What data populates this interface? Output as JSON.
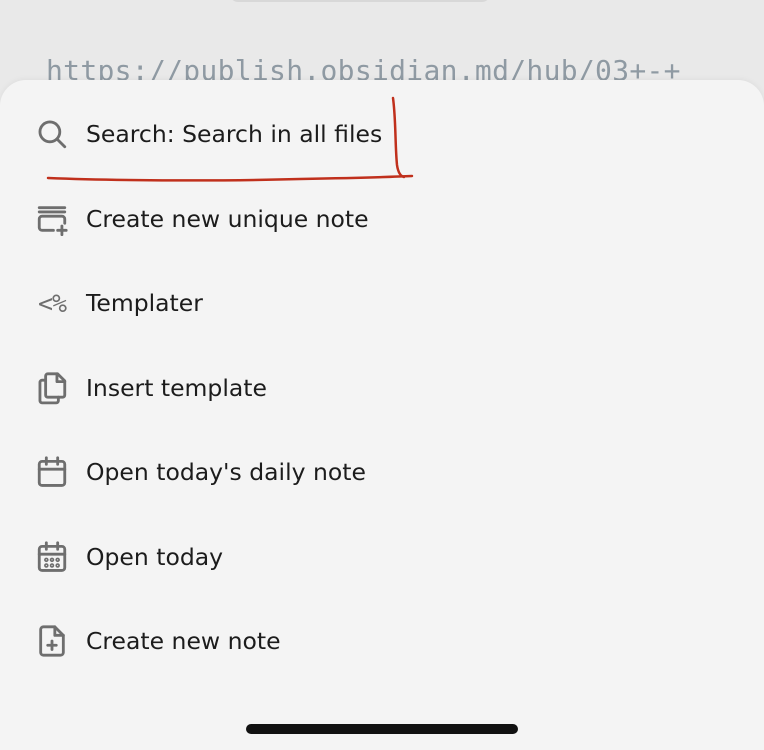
{
  "background": {
    "url_text": "https://publish.obsidian.md/hub/03+-+"
  },
  "menu": {
    "items": [
      {
        "label": "Search: Search in all files",
        "icon": "search-icon"
      },
      {
        "label": "Create new unique note",
        "icon": "unique-note-icon"
      },
      {
        "label": "Templater",
        "icon": "templater-icon",
        "glyph": "<%"
      },
      {
        "label": "Insert template",
        "icon": "files-icon"
      },
      {
        "label": "Open today's daily note",
        "icon": "calendar-icon"
      },
      {
        "label": "Open today",
        "icon": "calendar-days-icon"
      },
      {
        "label": "Create new note",
        "icon": "file-plus-icon"
      }
    ]
  },
  "colors": {
    "annotation": "#c0301c",
    "icon": "#6e6e6e",
    "text": "#1c1c1c",
    "sheet": "#f4f4f4"
  }
}
